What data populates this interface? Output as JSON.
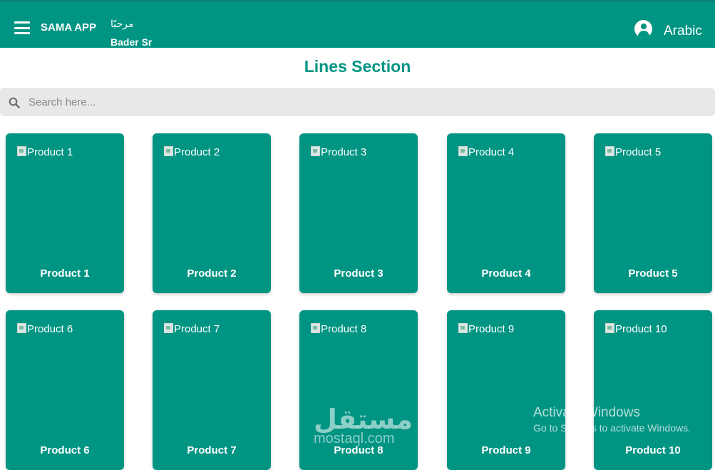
{
  "header": {
    "app_name": "SAMA APP",
    "greeting": "مرحبًا",
    "username": "Bader Sr",
    "language": "Arabic"
  },
  "section_title": "Lines Section",
  "search": {
    "placeholder": "Search here..."
  },
  "products": [
    {
      "alt": "Product 1",
      "name": "Product 1"
    },
    {
      "alt": "Product 2",
      "name": "Product 2"
    },
    {
      "alt": "Product 3",
      "name": "Product 3"
    },
    {
      "alt": "Product 4",
      "name": "Product 4"
    },
    {
      "alt": "Product 5",
      "name": "Product 5"
    },
    {
      "alt": "Product 6",
      "name": "Product 6"
    },
    {
      "alt": "Product 7",
      "name": "Product 7"
    },
    {
      "alt": "Product 8",
      "name": "Product 8"
    },
    {
      "alt": "Product 9",
      "name": "Product 9"
    },
    {
      "alt": "Product 10",
      "name": "Product 10"
    }
  ],
  "watermark": {
    "arabic": "مستقل",
    "url": "mostaql.com"
  },
  "os_overlay": {
    "title": "Activate Windows",
    "subtitle": "Go to Settings to activate Windows."
  },
  "colors": {
    "brand": "#009483",
    "search_bg": "#e8e8ea"
  }
}
